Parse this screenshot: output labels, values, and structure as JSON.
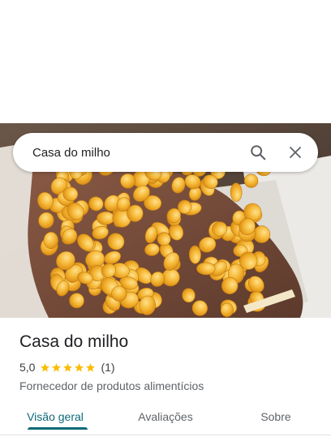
{
  "search": {
    "query": "Casa do milho"
  },
  "icons": {
    "search": "search-icon",
    "close": "close-icon",
    "star": "star-icon"
  },
  "place": {
    "name": "Casa do milho",
    "rating": "5,0",
    "rating_stars": 5,
    "review_count": "(1)",
    "category": "Fornecedor de produtos alimentícios",
    "photo_subject": "corn-kernels-in-hand"
  },
  "tabs": [
    {
      "label": "Visão geral",
      "active": true
    },
    {
      "label": "Avaliações",
      "active": false
    },
    {
      "label": "Sobre",
      "active": false
    }
  ],
  "colors": {
    "accent": "#0b6a77",
    "star": "#fbbc04",
    "text": "#202124",
    "muted": "#5f6368"
  }
}
